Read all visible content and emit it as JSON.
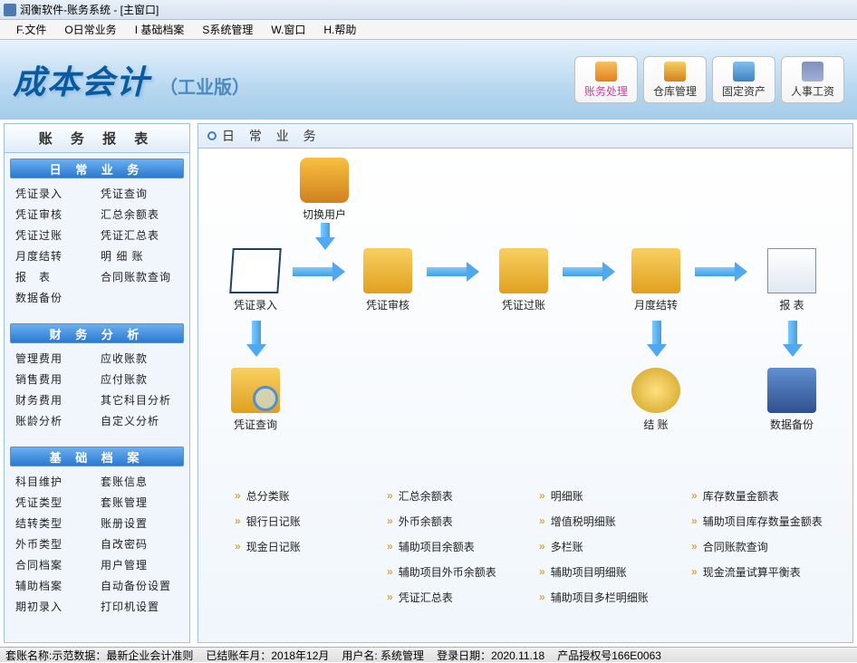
{
  "titlebar": {
    "text": "润衡软件-账务系统 - [主窗口]"
  },
  "menubar": [
    "F.文件",
    "O日常业务",
    "I 基础档案",
    "S系统管理",
    "W.窗口",
    "H.帮助"
  ],
  "banner": {
    "title": "成本会计",
    "subtitle": "（工业版）"
  },
  "headerButtons": [
    {
      "label": "账务处理",
      "active": true
    },
    {
      "label": "仓库管理"
    },
    {
      "label": "固定资产"
    },
    {
      "label": "人事工资"
    }
  ],
  "sidebar": {
    "title": "账 务 报 表",
    "sections": [
      {
        "header": "日 常 业 务",
        "rows": [
          [
            "凭证录入",
            "凭证查询"
          ],
          [
            "凭证审核",
            "汇总余额表"
          ],
          [
            "凭证过账",
            "凭证汇总表"
          ],
          [
            "月度结转",
            "明 细 账"
          ],
          [
            "报　表",
            "合同账款查询"
          ],
          [
            "数据备份",
            ""
          ]
        ]
      },
      {
        "header": "财 务 分 析",
        "rows": [
          [
            "管理费用",
            "应收账款"
          ],
          [
            "销售费用",
            "应付账款"
          ],
          [
            "财务费用",
            "其它科目分析"
          ],
          [
            "账龄分析",
            "自定义分析"
          ]
        ]
      },
      {
        "header": "基 础 档 案",
        "rows": [
          [
            "科目维护",
            "套账信息"
          ],
          [
            "凭证类型",
            "套账管理"
          ],
          [
            "结转类型",
            "账册设置"
          ],
          [
            "外币类型",
            "自改密码"
          ],
          [
            "合同档案",
            "用户管理"
          ],
          [
            "辅助档案",
            "自动备份设置"
          ],
          [
            "期初录入",
            "打印机设置"
          ]
        ]
      }
    ]
  },
  "content": {
    "header": "日 常 业 务",
    "nodes": {
      "switch": "切换用户",
      "entry": "凭证录入",
      "audit": "凭证审核",
      "post": "凭证过账",
      "monthly": "月度结转",
      "report": "报 表",
      "query": "凭证查询",
      "close": "结 账",
      "backup": "数据备份"
    },
    "reportLinks": [
      "总分类账",
      "汇总余额表",
      "明细账",
      "库存数量金额表",
      "银行日记账",
      "外币余额表",
      "增值税明细账",
      "辅助项目库存数量金额表",
      "现金日记账",
      "辅助项目余额表",
      "多栏账",
      "合同账款查询",
      "",
      "辅助项目外币余额表",
      "辅助项目明细账",
      "现金流量试算平衡表",
      "",
      "凭证汇总表",
      "辅助项目多栏明细账",
      ""
    ]
  },
  "statusbar": {
    "p1": "套账名称:示范数据：最新企业会计准则",
    "p2": "已结账年月：2018年12月",
    "p3": "用户名: 系统管理",
    "p4": "登录日期：2020.11.18",
    "p5": "产品授权号166E0063"
  }
}
